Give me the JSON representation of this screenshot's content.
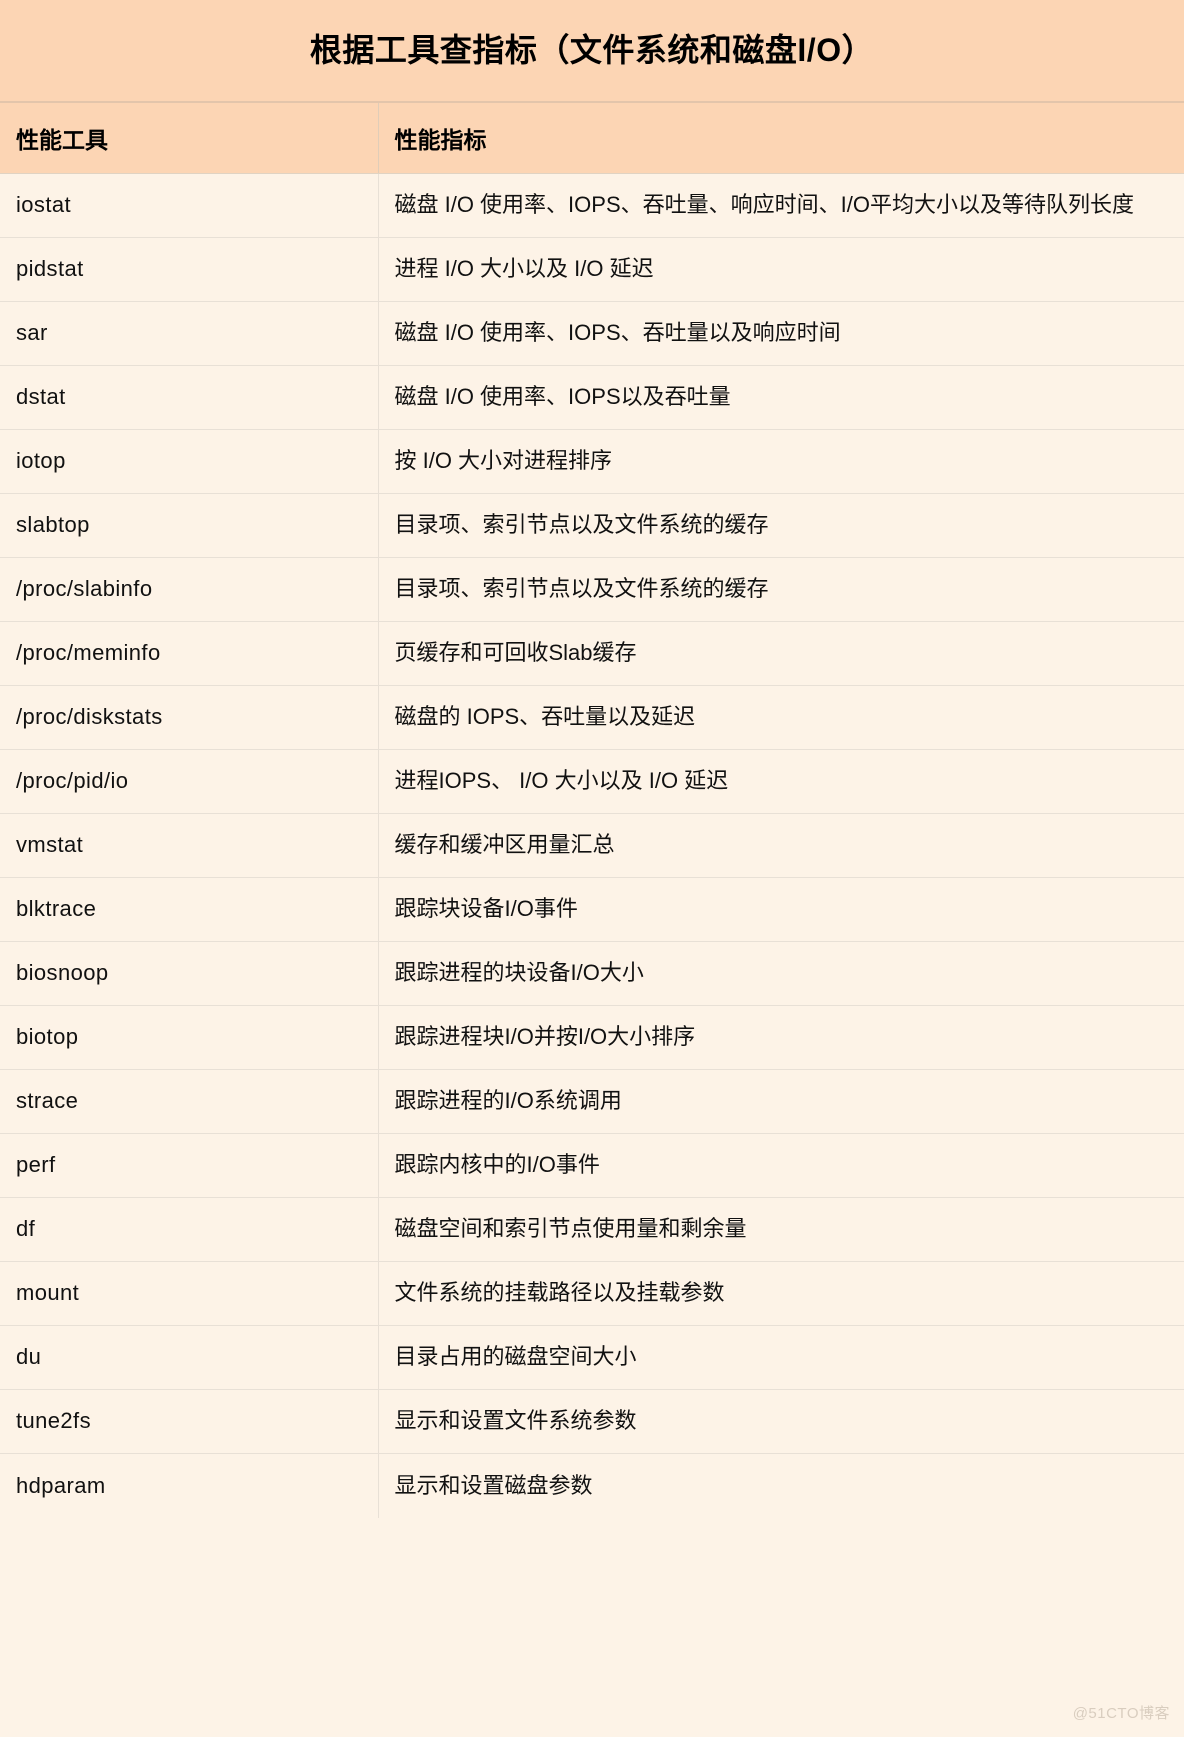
{
  "title": "根据工具查指标（文件系统和磁盘I/O）",
  "table": {
    "headers": {
      "tool": "性能工具",
      "metric": "性能指标"
    },
    "rows": [
      {
        "tool": "iostat",
        "metric": "磁盘 I/O 使用率、IOPS、吞吐量、响应时间、I/O平均大小以及等待队列长度"
      },
      {
        "tool": "pidstat",
        "metric": "进程 I/O 大小以及 I/O 延迟"
      },
      {
        "tool": "sar",
        "metric": "磁盘 I/O 使用率、IOPS、吞吐量以及响应时间"
      },
      {
        "tool": "dstat",
        "metric": "磁盘 I/O 使用率、IOPS以及吞吐量"
      },
      {
        "tool": "iotop",
        "metric": "按 I/O 大小对进程排序"
      },
      {
        "tool": "slabtop",
        "metric": "目录项、索引节点以及文件系统的缓存"
      },
      {
        "tool": "/proc/slabinfo",
        "metric": "目录项、索引节点以及文件系统的缓存"
      },
      {
        "tool": "/proc/meminfo",
        "metric": "页缓存和可回收Slab缓存"
      },
      {
        "tool": "/proc/diskstats",
        "metric": "磁盘的 IOPS、吞吐量以及延迟"
      },
      {
        "tool": "/proc/pid/io",
        "metric": "进程IOPS、 I/O 大小以及 I/O 延迟"
      },
      {
        "tool": "vmstat",
        "metric": "缓存和缓冲区用量汇总"
      },
      {
        "tool": "blktrace",
        "metric": "跟踪块设备I/O事件"
      },
      {
        "tool": "biosnoop",
        "metric": "跟踪进程的块设备I/O大小"
      },
      {
        "tool": "biotop",
        "metric": "跟踪进程块I/O并按I/O大小排序"
      },
      {
        "tool": "strace",
        "metric": "跟踪进程的I/O系统调用"
      },
      {
        "tool": "perf",
        "metric": "跟踪内核中的I/O事件"
      },
      {
        "tool": "df",
        "metric": "磁盘空间和索引节点使用量和剩余量"
      },
      {
        "tool": "mount",
        "metric": "文件系统的挂载路径以及挂载参数"
      },
      {
        "tool": "du",
        "metric": "目录占用的磁盘空间大小"
      },
      {
        "tool": "tune2fs",
        "metric": "显示和设置文件系统参数"
      },
      {
        "tool": "hdparam",
        "metric": "显示和设置磁盘参数"
      }
    ]
  },
  "watermark": "@51CTO博客",
  "colors": {
    "banner_background": "#FCD5B4",
    "header_background": "#FCD5B4",
    "body_background": "#FDF3E7",
    "border": "#E8E0D6",
    "text": "#111111",
    "watermark_text": "#D9CDBF"
  }
}
